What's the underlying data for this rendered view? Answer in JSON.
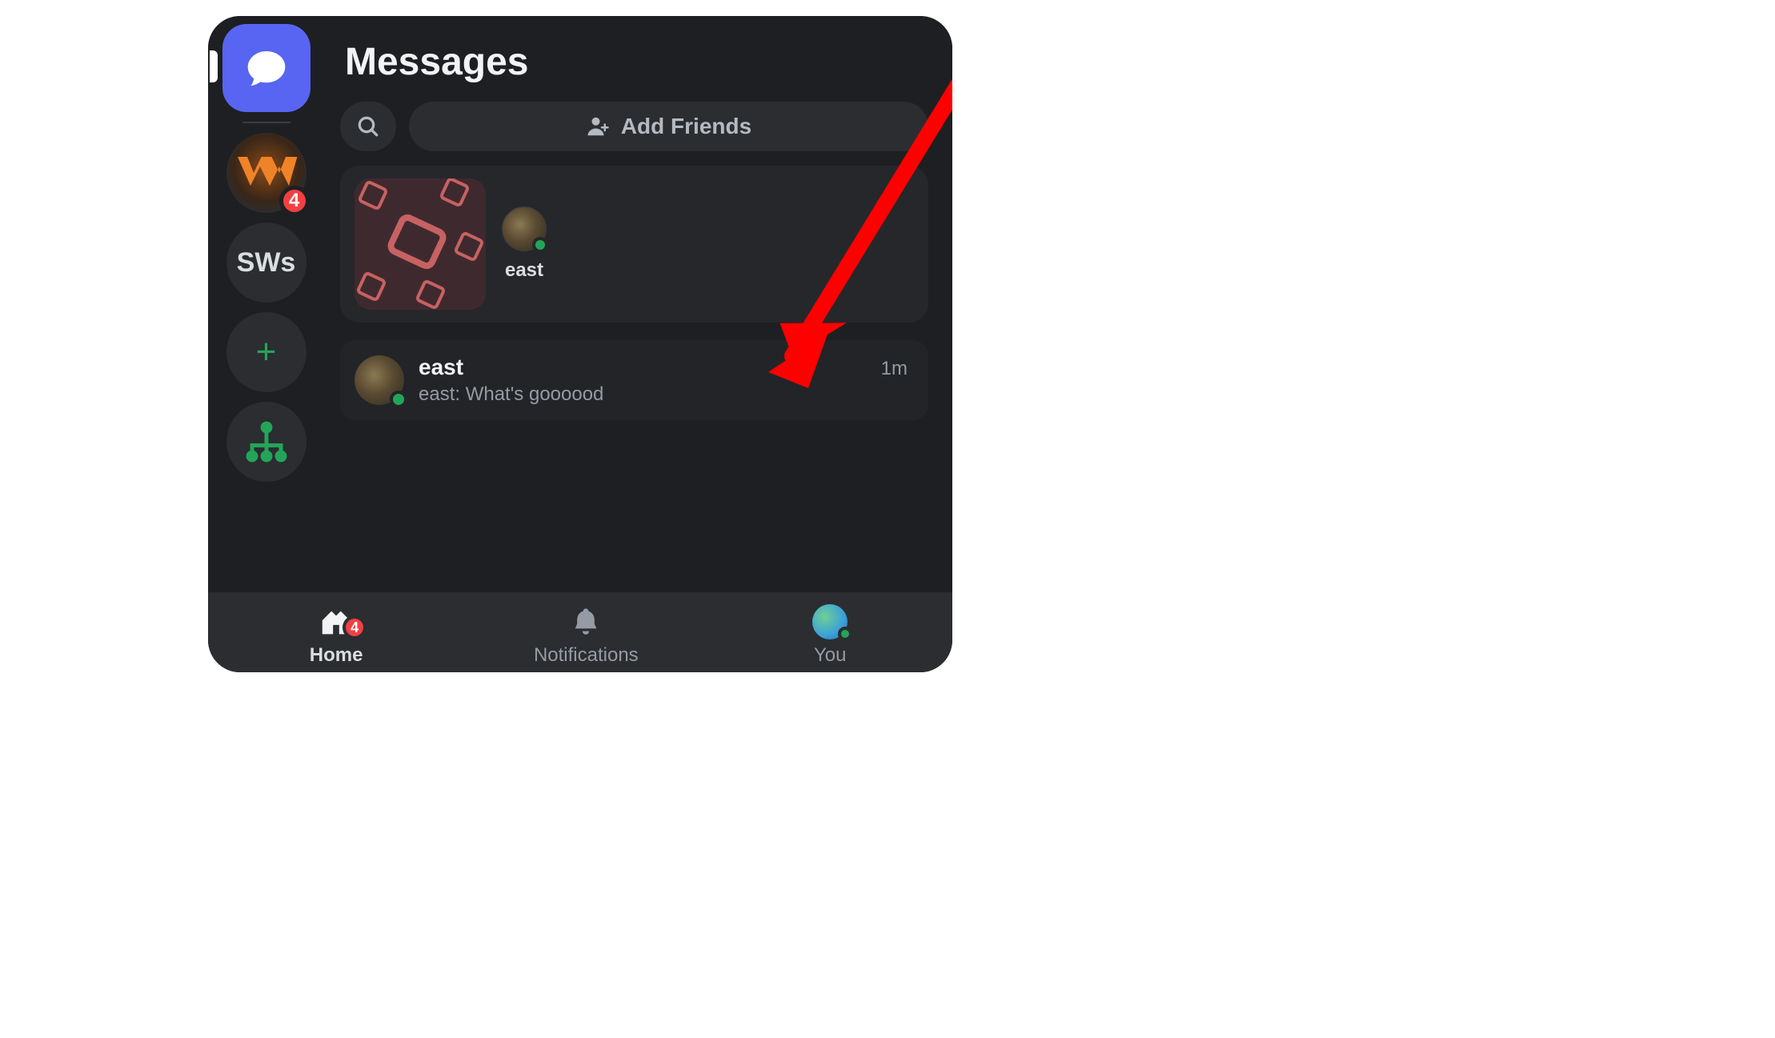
{
  "header": {
    "title": "Messages"
  },
  "actions": {
    "add_friends_label": "Add Friends"
  },
  "rail": {
    "server_sws_label": "SWs",
    "server_w_badge": "4"
  },
  "active_now": {
    "users": [
      {
        "name": "east"
      }
    ]
  },
  "dm_list": [
    {
      "name": "east",
      "preview": "east: What's goooood",
      "time": "1m"
    }
  ],
  "nav": {
    "home_label": "Home",
    "home_badge": "4",
    "notifications_label": "Notifications",
    "you_label": "You"
  }
}
